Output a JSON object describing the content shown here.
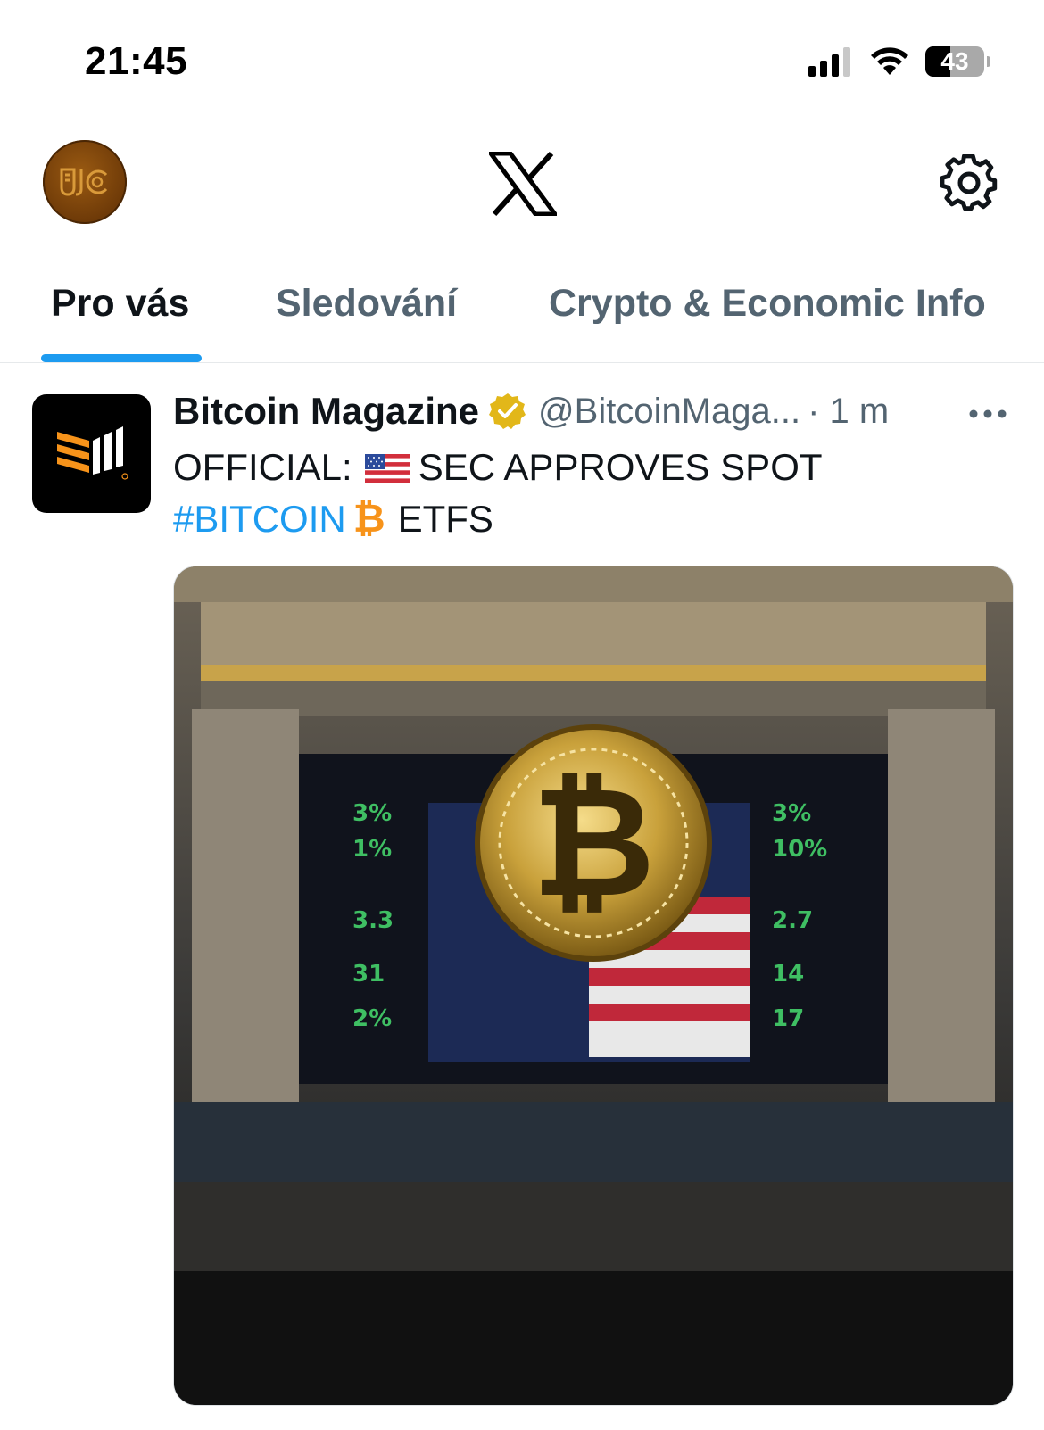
{
  "status_bar": {
    "time": "21:45",
    "battery_level": "43",
    "battery_fraction": 0.43
  },
  "top_bar": {
    "logo_icon": "x-logo-icon",
    "settings_icon": "gear-icon"
  },
  "tabs": [
    {
      "label": "Pro vás",
      "active": true
    },
    {
      "label": "Sledování",
      "active": false
    },
    {
      "label": "Crypto & Economic Info",
      "active": false
    }
  ],
  "tweet": {
    "author_name": "Bitcoin Magazine",
    "handle": "@BitcoinMaga...",
    "time": "· 1 m",
    "text_part1": "OFFICIAL:",
    "text_part2": "SEC APPROVES SPOT",
    "hashtag": "#BITCOIN",
    "btc_symbol": "₿",
    "text_part3": "ETFS",
    "media_description_icon": "bitcoin-coin-image"
  },
  "colors": {
    "accent": "#1d9bf0",
    "text_primary": "#0f1419",
    "text_secondary": "#536471",
    "bitcoin_orange": "#f7931a",
    "verified_gold": "#e2b719"
  }
}
